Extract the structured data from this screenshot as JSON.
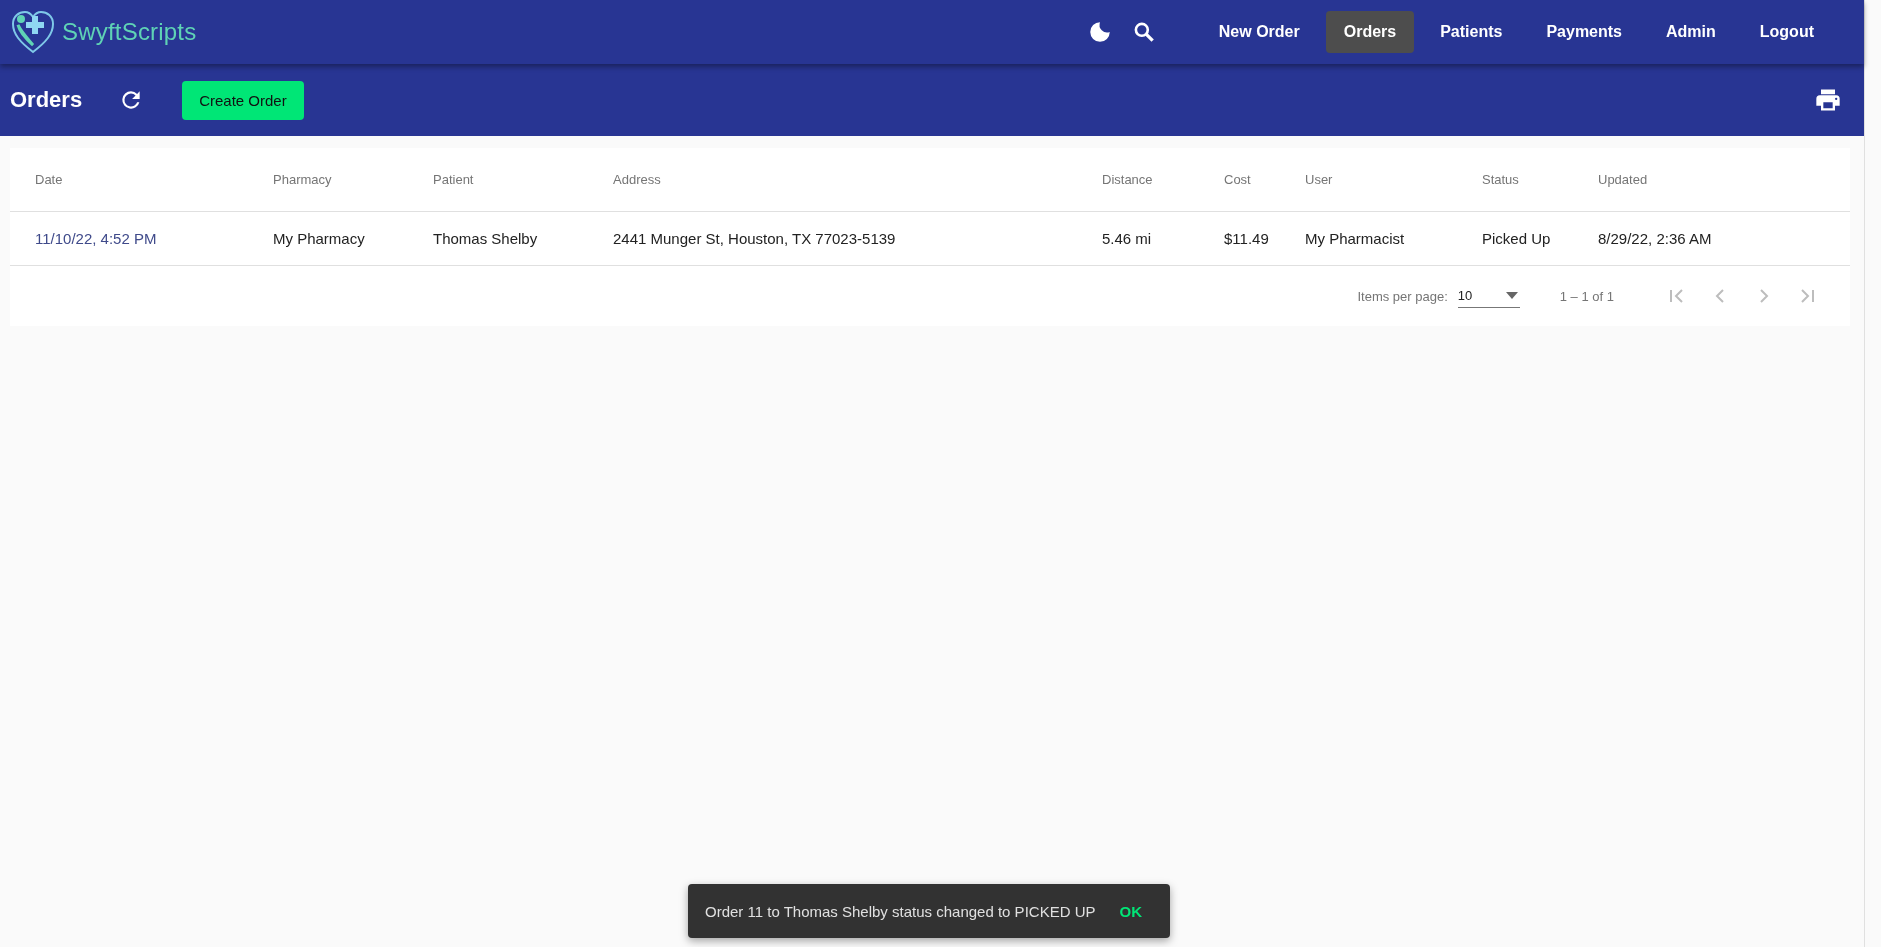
{
  "brand": "SwyftScripts",
  "nav": [
    {
      "label": "New Order",
      "selected": false
    },
    {
      "label": "Orders",
      "selected": true
    },
    {
      "label": "Patients",
      "selected": false
    },
    {
      "label": "Payments",
      "selected": false
    },
    {
      "label": "Admin",
      "selected": false
    },
    {
      "label": "Logout",
      "selected": false
    }
  ],
  "toolbar": {
    "title": "Orders",
    "create_button": "Create Order"
  },
  "table": {
    "columns": [
      "Date",
      "Pharmacy",
      "Patient",
      "Address",
      "Distance",
      "Cost",
      "User",
      "Status",
      "Updated"
    ],
    "rows": [
      [
        "11/10/22, 4:52 PM",
        "My Pharmacy",
        "Thomas Shelby",
        "2441 Munger St, Houston, TX 77023-5139",
        "5.46 mi",
        "$11.49",
        "My Pharmacist",
        "Picked Up",
        "8/29/22, 2:36 AM"
      ]
    ]
  },
  "paginator": {
    "label": "Items per page:",
    "page_size": "10",
    "range": "1 – 1 of 1"
  },
  "snackbar": {
    "message": "Order 11 to Thomas Shelby status changed to PICKED UP",
    "action": "OK"
  }
}
